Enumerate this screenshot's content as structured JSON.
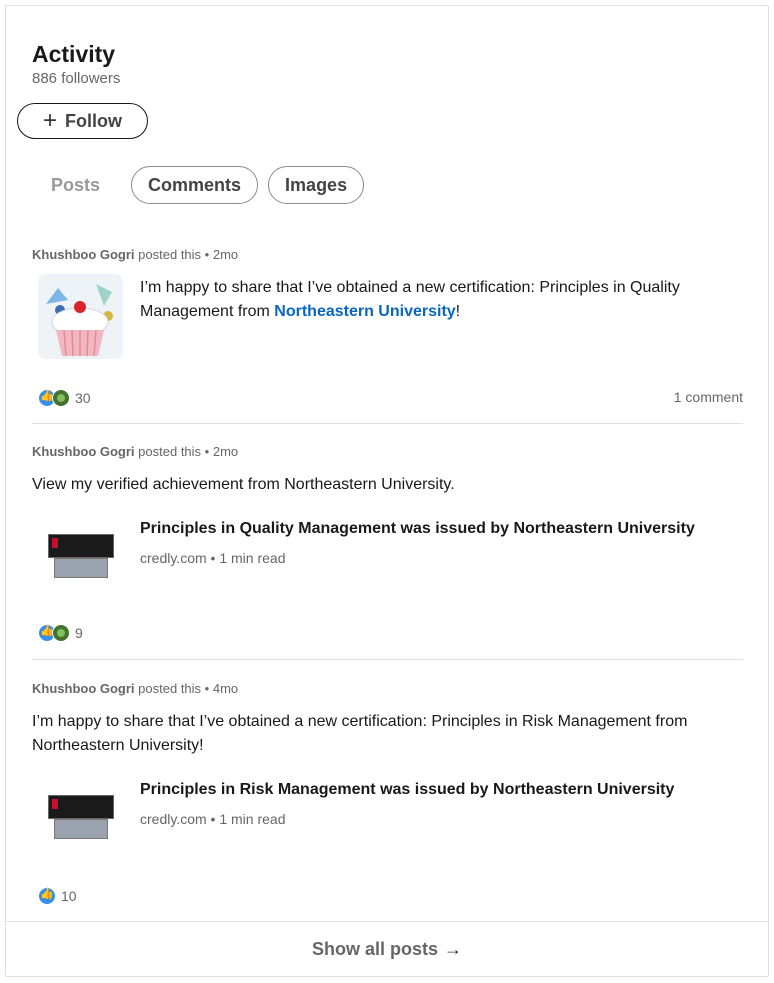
{
  "activity": {
    "title": "Activity",
    "followers": "886 followers",
    "follow_button": "Follow",
    "follow_icon": "plus-icon"
  },
  "tabs": [
    {
      "label": "Posts",
      "selected": false
    },
    {
      "label": "Comments",
      "selected": false
    },
    {
      "label": "Images",
      "selected": false
    }
  ],
  "posts": [
    {
      "author": "Khushboo Gogri",
      "action": "posted this",
      "time": "2mo",
      "text_before": "I’m happy to share that I’ve obtained a new certification: Principles in Quality Management from ",
      "text_link": "Northeastern University",
      "text_after": "!",
      "reactions": "30",
      "comments": "1 comment"
    },
    {
      "author": "Khushboo Gogri",
      "action": "posted this",
      "time": "2mo",
      "text": "View my verified achievement from Northeastern University.",
      "article_title": "Principles in Quality Management was issued by Northeastern University",
      "article_source": "credly.com",
      "article_read": "1 min read",
      "reactions": "9"
    },
    {
      "author": "Khushboo Gogri",
      "action": "posted this",
      "time": "4mo",
      "text": "I’m happy to share that I’ve obtained a new certification: Principles in Risk Management from Northeastern University!",
      "article_title": "Principles in Risk Management was issued by Northeastern University",
      "article_source": "credly.com",
      "article_read": "1 min read",
      "reactions": "10"
    }
  ],
  "separator": "•",
  "show_all": "Show all posts",
  "show_all_icon": "arrow-right-icon",
  "colors": {
    "link": "#0a66c2",
    "muted": "#666666",
    "text": "#191919",
    "like": "#378fe9",
    "celebrate": "#44712e"
  }
}
